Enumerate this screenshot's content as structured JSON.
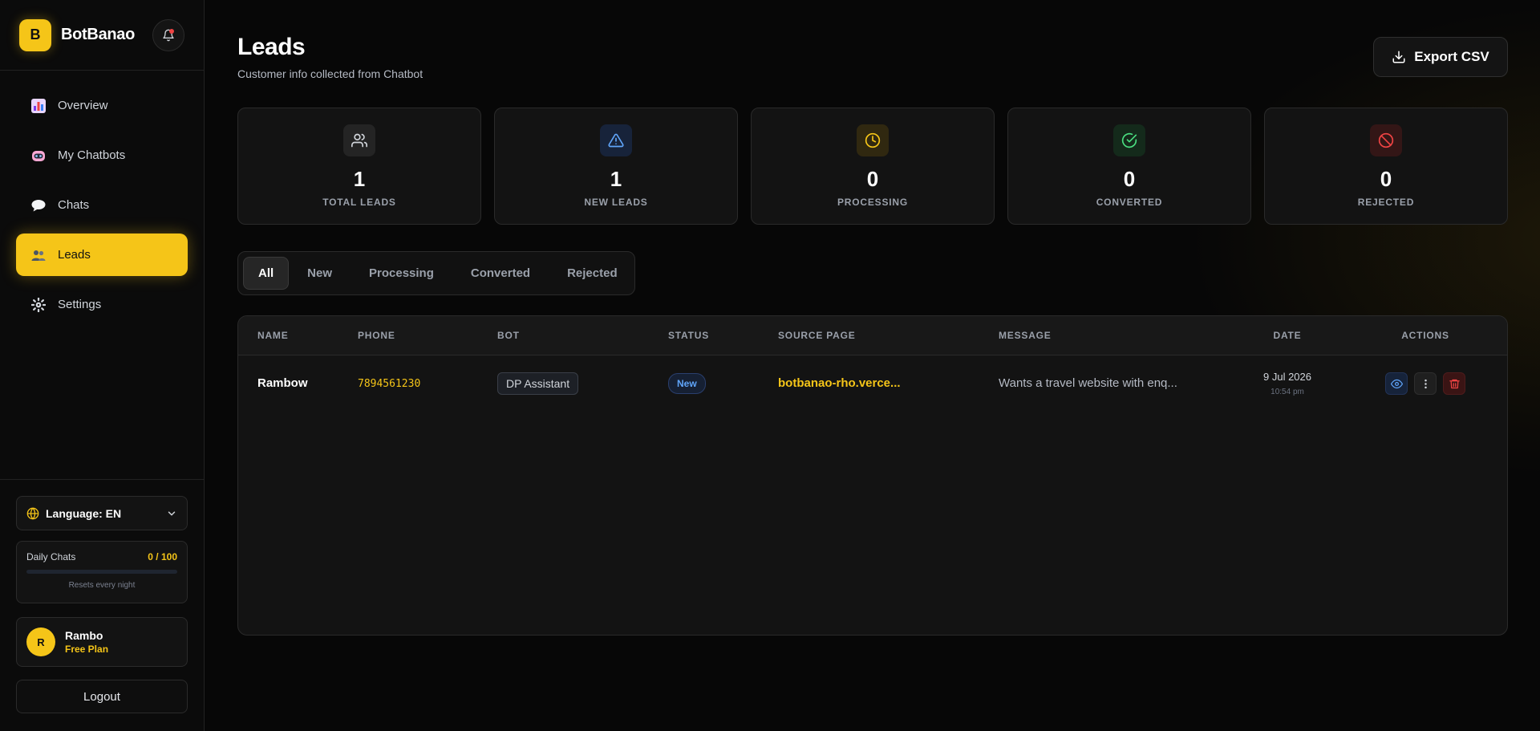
{
  "brand": {
    "logo_letter": "B",
    "name": "BotBanao",
    "accent": "#f5c518"
  },
  "nav": {
    "items": [
      {
        "label": "Overview",
        "icon": "bar-chart-icon",
        "active": false
      },
      {
        "label": "My Chatbots",
        "icon": "robot-icon",
        "active": false
      },
      {
        "label": "Chats",
        "icon": "speech-bubble-icon",
        "active": false
      },
      {
        "label": "Leads",
        "icon": "users-icon",
        "active": true
      },
      {
        "label": "Settings",
        "icon": "gear-icon",
        "active": false
      }
    ]
  },
  "sidebar_bottom": {
    "language_label": "Language: EN",
    "daily_chats": {
      "label": "Daily Chats",
      "count": "0 / 100",
      "progress": 0,
      "note": "Resets every night"
    },
    "user": {
      "initial": "R",
      "name": "Rambo",
      "plan": "Free Plan"
    },
    "logout_label": "Logout"
  },
  "header": {
    "title": "Leads",
    "subtitle": "Customer info collected from Chatbot",
    "export_label": "Export CSV"
  },
  "stats": [
    {
      "value": "1",
      "label": "TOTAL LEADS",
      "icon": "users-icon",
      "color": "#d1d5db"
    },
    {
      "value": "1",
      "label": "NEW LEADS",
      "icon": "alert-triangle-icon",
      "color": "#60a5fa"
    },
    {
      "value": "0",
      "label": "PROCESSING",
      "icon": "clock-icon",
      "color": "#f5c518"
    },
    {
      "value": "0",
      "label": "CONVERTED",
      "icon": "check-circle-icon",
      "color": "#4ade80"
    },
    {
      "value": "0",
      "label": "REJECTED",
      "icon": "ban-icon",
      "color": "#ef4444"
    }
  ],
  "tabs": [
    {
      "label": "All",
      "active": true
    },
    {
      "label": "New",
      "active": false
    },
    {
      "label": "Processing",
      "active": false
    },
    {
      "label": "Converted",
      "active": false
    },
    {
      "label": "Rejected",
      "active": false
    }
  ],
  "table": {
    "columns": [
      "NAME",
      "PHONE",
      "BOT",
      "STATUS",
      "SOURCE PAGE",
      "MESSAGE",
      "DATE",
      "ACTIONS"
    ],
    "rows": [
      {
        "name": "Rambow",
        "phone": "7894561230",
        "bot": "DP Assistant",
        "status": "New",
        "source": "botbanao-rho.verce...",
        "message": "Wants a travel website with enq...",
        "date": "9 Jul 2026",
        "time": "10:54 pm",
        "actions": [
          "eye-icon",
          "more-vertical-icon",
          "trash-icon"
        ]
      }
    ]
  }
}
